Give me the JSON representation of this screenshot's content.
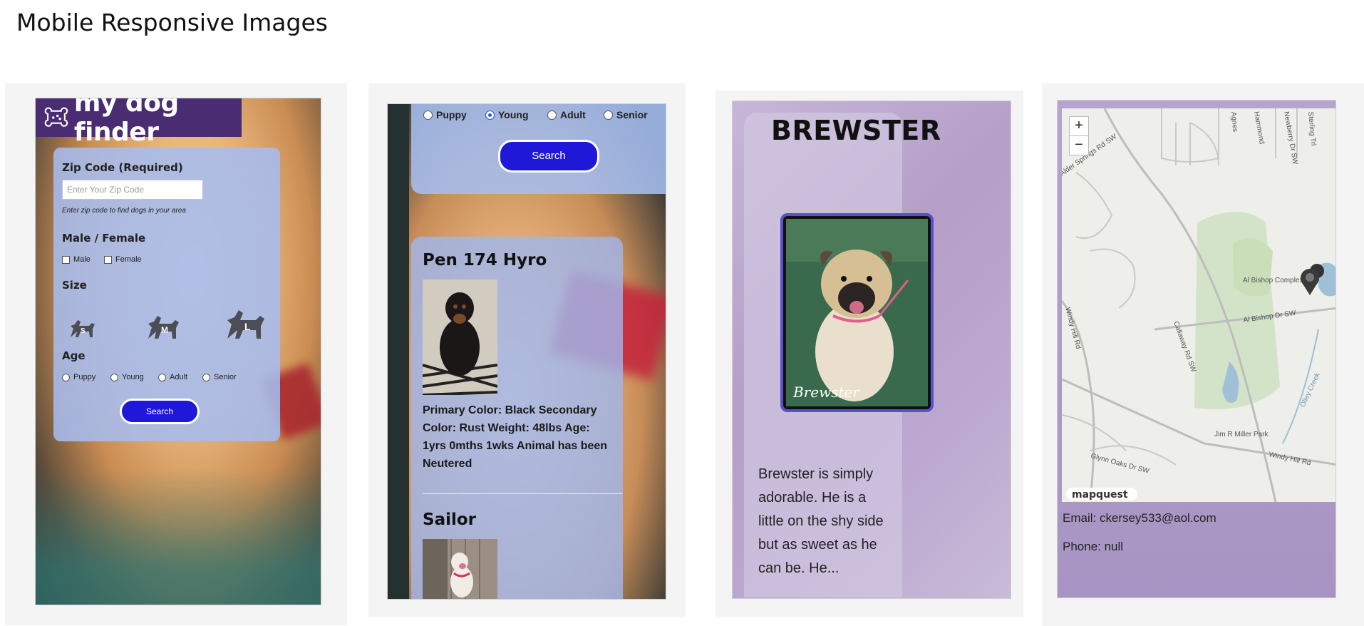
{
  "page": {
    "title": "Mobile Responsive Images"
  },
  "screen1": {
    "logo": "my dog finder",
    "zip_label": "Zip Code (Required)",
    "zip_placeholder": "Enter Your Zip Code",
    "zip_hint": "Enter zip code to find dogs in your area",
    "gender_label": "Male / Female",
    "gender_options": [
      "Male",
      "Female"
    ],
    "size_label": "Size",
    "size_options": [
      "S",
      "M",
      "L"
    ],
    "age_label": "Age",
    "age_options": [
      "Puppy",
      "Young",
      "Adult",
      "Senior"
    ],
    "search_label": "Search"
  },
  "screen2": {
    "age_options": [
      "Puppy",
      "Young",
      "Adult",
      "Senior"
    ],
    "selected_age": "Young",
    "search_label": "Search",
    "pets": [
      {
        "name": "Pen 174 Hyro",
        "description": "Primary Color: Black Secondary Color: Rust Weight: 48lbs Age: 1yrs 0mths 1wks Animal has been Neutered"
      },
      {
        "name": "Sailor",
        "description": ""
      }
    ]
  },
  "screen3": {
    "name": "BREWSTER",
    "photo_caption": "Brewster",
    "description": "Brewster is simply adorable. He is a little on the shy side but as sweet as he can be. He..."
  },
  "screen4": {
    "map": {
      "zoom_in": "+",
      "zoom_out": "−",
      "attribution": "mapquest",
      "roads": [
        "Windy Hill Rd",
        "Callaway Rd SW",
        "Al Bishop Dr SW",
        "Windy Hill Rd",
        "Glynn Oaks Dr SW",
        "Alder Springs Rd SW",
        "Hammond",
        "Newberry Dr SW",
        "Sterling Trl",
        "Olley Creek",
        "Agnes"
      ],
      "places": [
        "Al Bishop Complex",
        "Jim R Miller Park"
      ]
    },
    "email": "Email: ckersey533@aol.com",
    "phone": "Phone: null"
  },
  "colors": {
    "button_blue": "#1f18d8",
    "logo_purple": "#4a2c72",
    "panel_blue": "#a6bcee"
  }
}
